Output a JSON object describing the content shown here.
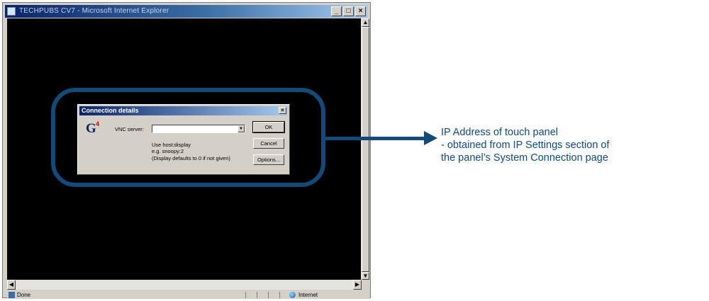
{
  "window": {
    "title": "TECHPUBS CV7 - Microsoft Internet Explorer",
    "buttons": [
      "_",
      "□",
      "×"
    ]
  },
  "dialog": {
    "title": "Connection details",
    "close": "×",
    "logo": {
      "letter": "G",
      "sup": "4"
    },
    "vnc_label": "VNC server:",
    "vnc_value": "",
    "hint": [
      "Use host:display",
      "e.g. snoopy:2",
      "(Display defaults to 0 if not given)"
    ],
    "buttons": {
      "ok": "OK",
      "cancel": "Cancel",
      "options": "Options..."
    }
  },
  "statusbar": {
    "text": "Done",
    "zone": "Internet"
  },
  "annotation": {
    "lines": [
      "IP Address of touch panel",
      "- obtained from IP Settings section of",
      " the panel’s System Connection page"
    ],
    "color": "#134a7a"
  }
}
